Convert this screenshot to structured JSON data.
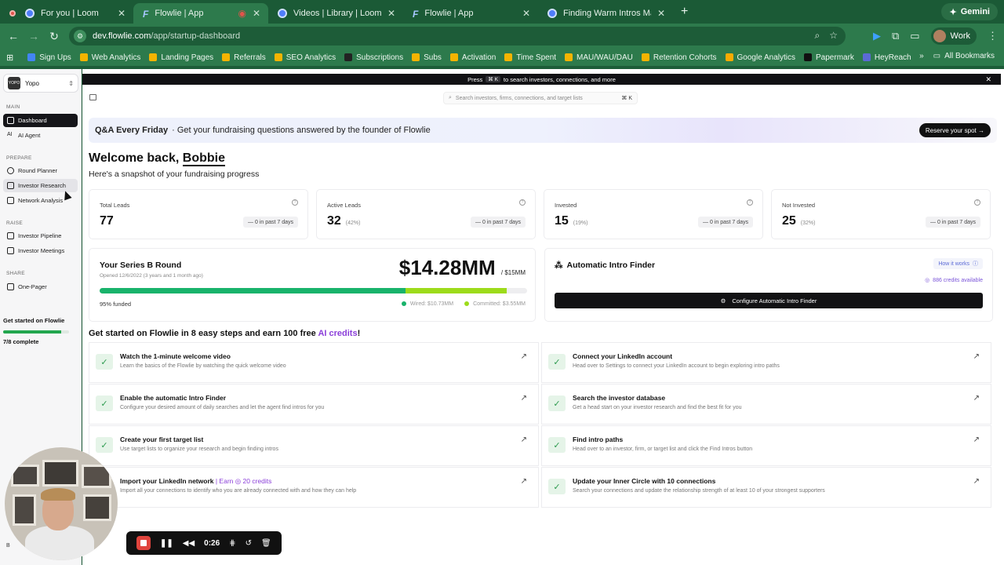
{
  "browser": {
    "tabs": [
      {
        "label": "For you | Loom",
        "icon": "loom-icon",
        "recording": true
      },
      {
        "label": "Flowlie | App",
        "icon": "flowlie-icon",
        "active": true
      },
      {
        "label": "Videos | Library | Loom",
        "icon": "loom-icon"
      },
      {
        "label": "Flowlie | App",
        "icon": "flowlie-icon"
      },
      {
        "label": "Finding Warm Intros Manually",
        "icon": "loom-icon"
      }
    ],
    "gemini_label": "Gemini",
    "url_domain": "dev.flowlie.com",
    "url_path": "/app/startup-dashboard",
    "profile_label": "Work",
    "bookmarks": [
      {
        "label": "Sign Ups",
        "color": "#4285f4"
      },
      {
        "label": "Web Analytics",
        "color": "#f4b400"
      },
      {
        "label": "Landing Pages",
        "color": "#f4b400"
      },
      {
        "label": "Referrals",
        "color": "#f4b400"
      },
      {
        "label": "SEO Analytics",
        "color": "#f4b400"
      },
      {
        "label": "Subscriptions",
        "color": "#222222"
      },
      {
        "label": "Subs",
        "color": "#f4b400"
      },
      {
        "label": "Activation",
        "color": "#f4b400"
      },
      {
        "label": "Time Spent",
        "color": "#f4b400"
      },
      {
        "label": "MAU/WAU/DAU",
        "color": "#f4b400"
      },
      {
        "label": "Retention Cohorts",
        "color": "#f4b400"
      },
      {
        "label": "Google Analytics",
        "color": "#f9ab00"
      },
      {
        "label": "Papermark",
        "color": "#111111"
      },
      {
        "label": "HeyReach",
        "color": "#5b6ad6"
      }
    ],
    "all_bookmarks_label": "All Bookmarks"
  },
  "sidebar": {
    "workspace": "Yopo",
    "workspace_logo": "YOPO",
    "sections": {
      "main": "MAIN",
      "prepare": "PREPARE",
      "raise": "RAISE",
      "share": "SHARE"
    },
    "items": [
      {
        "label": "Dashboard",
        "active": true
      },
      {
        "label": "AI Agent"
      },
      {
        "label": "Round Planner"
      },
      {
        "label": "Investor Research",
        "hover": true
      },
      {
        "label": "Network Analysis"
      },
      {
        "label": "Investor Pipeline"
      },
      {
        "label": "Investor Meetings"
      },
      {
        "label": "One-Pager"
      }
    ],
    "get_started": "Get started on Flowlie",
    "progress_fraction": 0.875,
    "progress_label": "7/8 complete",
    "user_initial": "B"
  },
  "main": {
    "banner_press": "Press",
    "banner_key1": "⌘",
    "banner_key2": "K",
    "banner_text": "to search investors, connections, and more",
    "search_placeholder": "Search investors, firms, connections, and target lists",
    "search_shortcut": "⌘ K",
    "qa_title": "Q&A Every Friday",
    "qa_text": "· Get your fundraising questions answered by the founder of Flowlie",
    "qa_button": "Reserve your spot →",
    "welcome_prefix": "Welcome back,",
    "welcome_name": "Bobbie",
    "subtitle": "Here's a snapshot of your fundraising progress",
    "stats": [
      {
        "label": "Total Leads",
        "value": "77",
        "pct": "",
        "change": "— 0  in past 7 days"
      },
      {
        "label": "Active Leads",
        "value": "32",
        "pct": "(42%)",
        "change": "— 0  in past 7 days"
      },
      {
        "label": "Invested",
        "value": "15",
        "pct": "(19%)",
        "change": "— 0  in past 7 days"
      },
      {
        "label": "Not Invested",
        "value": "25",
        "pct": "(32%)",
        "change": "— 0  in past 7 days"
      }
    ],
    "round": {
      "title": "Your Series B Round",
      "opened": "Opened 12/6/2022 (3 years and 1 month ago)",
      "amount": "$14.28MM",
      "target": "/ $15MM",
      "funded": "95% funded",
      "wired_label": "Wired: $10.73MM",
      "committed_label": "Committed: $3.55MM",
      "wired_fraction": 0.715,
      "committed_fraction": 0.237,
      "wired_color": "#19b36b",
      "committed_color": "#9ddb1b"
    },
    "intro": {
      "title": "Automatic Intro Finder",
      "how": "How it works",
      "credits": "886 credits available",
      "button": "Configure Automatic Intro Finder"
    },
    "steps_head_prefix": "Get started on Flowlie in 8 easy steps and earn 100 free",
    "steps_head_link": "AI credits",
    "steps_head_suffix": "!",
    "steps": [
      {
        "title": "Watch the 1-minute welcome video",
        "desc": "Learn the basics of the Flowlie by watching the quick welcome video",
        "done": true
      },
      {
        "title": "Connect your LinkedIn account",
        "desc": "Head over to Settings to connect your LinkedIn account to begin exploring intro paths",
        "done": true
      },
      {
        "title": "Enable the automatic Intro Finder",
        "desc": "Configure your desired amount of daily searches and let the agent find intros for you",
        "done": true
      },
      {
        "title": "Search the investor database",
        "desc": "Get a head start on your investor research and find the best fit for you",
        "done": true
      },
      {
        "title": "Create your first target list",
        "desc": "Use target lists to organize your research and begin finding intros",
        "done": true
      },
      {
        "title": "Find intro paths",
        "desc": "Head over to an investor, firm, or target list and click the Find Intros button",
        "done": true
      },
      {
        "title": "Import your LinkedIn network",
        "earn": "| Earn ◎ 20 credits",
        "desc": "Import all your connections to identify who you are already connected with and how they can help",
        "done": false
      },
      {
        "title": "Update your Inner Circle with 10 connections",
        "desc": "Search your connections and update the relationship strength of at least 10 of your strongest supporters",
        "done": true
      }
    ]
  },
  "loom": {
    "timer": "0:26"
  }
}
